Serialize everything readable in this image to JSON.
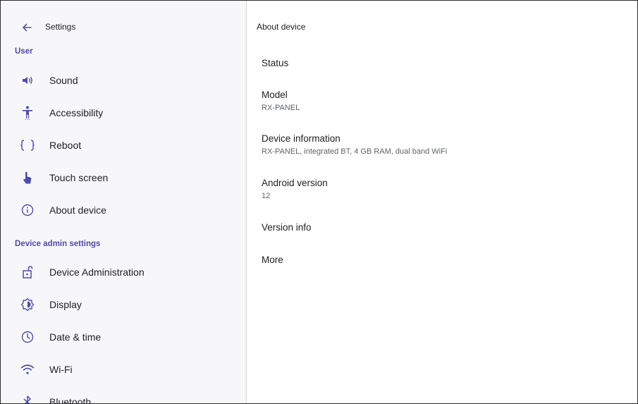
{
  "header": {
    "title": "Settings"
  },
  "sections": {
    "user": "User",
    "device_admin": "Device admin settings"
  },
  "user_items": [
    {
      "label": "Sound",
      "icon": "volume-icon"
    },
    {
      "label": "Accessibility",
      "icon": "accessibility-icon"
    },
    {
      "label": "Reboot",
      "icon": "braces-icon"
    },
    {
      "label": "Touch screen",
      "icon": "touch-icon"
    },
    {
      "label": "About device",
      "icon": "info-icon"
    }
  ],
  "admin_items": [
    {
      "label": "Device Administration",
      "icon": "lock-open-icon"
    },
    {
      "label": "Display",
      "icon": "brightness-icon"
    },
    {
      "label": "Date & time",
      "icon": "clock-icon"
    },
    {
      "label": "Wi-Fi",
      "icon": "wifi-icon"
    },
    {
      "label": "Bluetooth",
      "icon": "bluetooth-icon"
    }
  ],
  "detail": {
    "title": "About device",
    "prefs": [
      {
        "title": "Status",
        "summary": ""
      },
      {
        "title": "Model",
        "summary": "RX-PANEL"
      },
      {
        "title": "Device information",
        "summary": "RX-PANEL, integrated BT, 4 GB RAM, dual band WiFi"
      },
      {
        "title": "Android version",
        "summary": "12"
      },
      {
        "title": "Version info",
        "summary": ""
      },
      {
        "title": "More",
        "summary": ""
      }
    ]
  },
  "colors": {
    "accent": "#4c4ca6",
    "left_bg": "#f7f7f9"
  }
}
